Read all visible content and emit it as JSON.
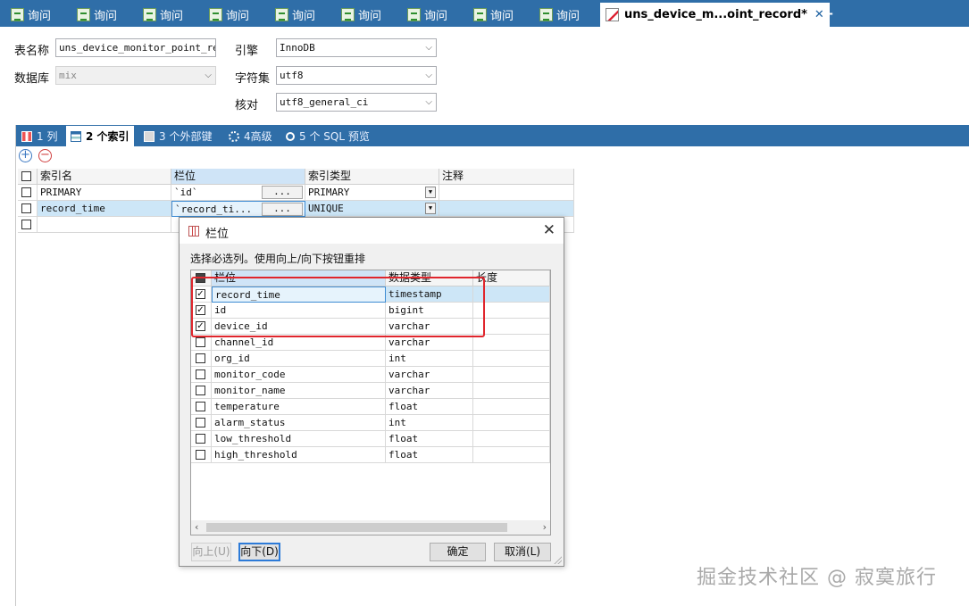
{
  "tabs": [
    {
      "label": "询问"
    },
    {
      "label": "询问"
    },
    {
      "label": "询问"
    },
    {
      "label": "询问"
    },
    {
      "label": "询问"
    },
    {
      "label": "询问"
    },
    {
      "label": "询问"
    },
    {
      "label": "询问"
    },
    {
      "label": "询问"
    }
  ],
  "active_tab": {
    "label": "uns_device_m...oint_record*",
    "close": "✕"
  },
  "new_tab": "+",
  "props": {
    "table_name_label": "表名称",
    "table_name_value": "uns_device_monitor_point_record",
    "database_label": "数据库",
    "database_value": "mix",
    "engine_label": "引擎",
    "engine_value": "InnoDB",
    "charset_label": "字符集",
    "charset_value": "utf8",
    "collation_label": "核对",
    "collation_value": "utf8_general_ci"
  },
  "subtabs": {
    "columns": "1 列",
    "indexes": "2 个索引",
    "foreign_keys": "3 个外部键",
    "advanced": "4高级",
    "sql_preview": "5 个 SQL 预览"
  },
  "index_grid": {
    "headers": [
      "索引名",
      "栏位",
      "索引类型",
      "注释"
    ],
    "rows": [
      {
        "name": "PRIMARY",
        "columns": "`id`",
        "type": "PRIMARY",
        "comment": ""
      },
      {
        "name": "record_time",
        "columns": "`record_ti...",
        "type": "UNIQUE",
        "comment": ""
      }
    ],
    "ellipsis": "...",
    "dropdown": "▼"
  },
  "dialog": {
    "title": "栏位",
    "instruction": "选择必选列。使用向上/向下按钮重排",
    "headers": [
      "栏位",
      "数据类型",
      "长度"
    ],
    "rows": [
      {
        "name": "record_time",
        "type": "timestamp",
        "checked": true
      },
      {
        "name": "id",
        "type": "bigint",
        "checked": true
      },
      {
        "name": "device_id",
        "type": "varchar",
        "checked": true
      },
      {
        "name": "channel_id",
        "type": "varchar",
        "checked": false
      },
      {
        "name": "org_id",
        "type": "int",
        "checked": false
      },
      {
        "name": "monitor_code",
        "type": "varchar",
        "checked": false
      },
      {
        "name": "monitor_name",
        "type": "varchar",
        "checked": false
      },
      {
        "name": "temperature",
        "type": "float",
        "checked": false
      },
      {
        "name": "alarm_status",
        "type": "int",
        "checked": false
      },
      {
        "name": "low_threshold",
        "type": "float",
        "checked": false
      },
      {
        "name": "high_threshold",
        "type": "float",
        "checked": false
      }
    ],
    "up_button": "向上(U)",
    "down_button": "向下(D)",
    "ok_button": "确定",
    "cancel_button": "取消(L)"
  },
  "watermark": "掘金技术社区 @ 寂寞旅行",
  "colors": {
    "tab_bar": "#2f6ea8",
    "highlight": "#e0262d",
    "selection": "#cde6f7"
  }
}
